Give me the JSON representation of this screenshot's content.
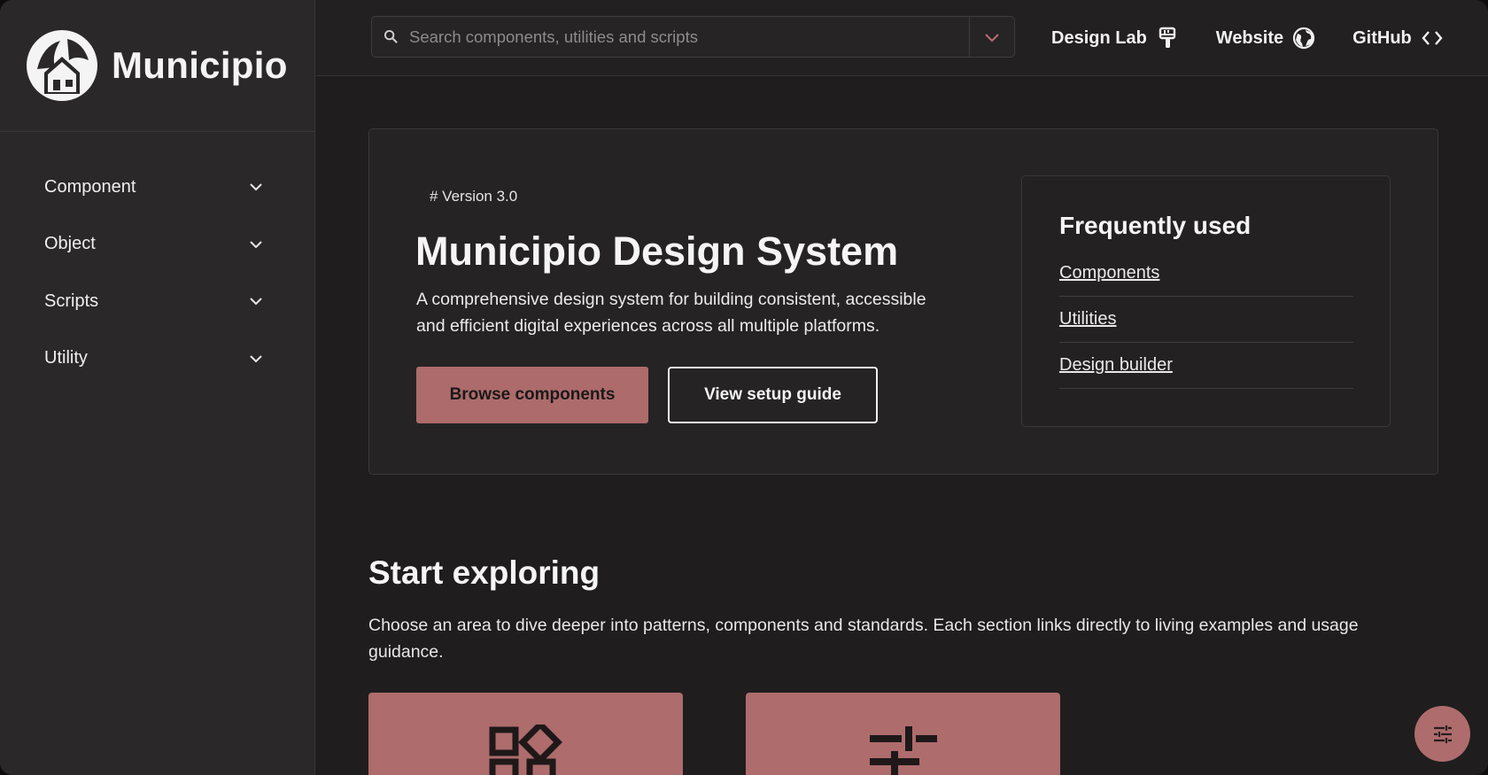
{
  "brand": {
    "name": "Municipio"
  },
  "sidebar": {
    "items": [
      {
        "label": "Component",
        "icon": "chevron-down-icon"
      },
      {
        "label": "Object",
        "icon": "chevron-down-icon"
      },
      {
        "label": "Scripts",
        "icon": "chevron-down-icon"
      },
      {
        "label": "Utility",
        "icon": "chevron-down-icon"
      }
    ]
  },
  "header": {
    "search_placeholder": "Search components, utilities and scripts",
    "search_value": "",
    "links": [
      {
        "label": "Design Lab",
        "icon": "brush-icon"
      },
      {
        "label": "Website",
        "icon": "globe-icon"
      },
      {
        "label": "GitHub",
        "icon": "code-icon"
      }
    ]
  },
  "hero": {
    "version": "# Version 3.0",
    "title": "Municipio Design System",
    "description": "A comprehensive design system for building consistent, accessible and efficient digital experiences across all multiple platforms.",
    "primary_button": "Browse components",
    "secondary_button": "View setup guide"
  },
  "frequently_used": {
    "title": "Frequently used",
    "links": [
      "Components",
      "Utilities",
      "Design builder"
    ]
  },
  "explore": {
    "title": "Start exploring",
    "description": "Choose an area to dive deeper into patterns, components and standards. Each section links directly to living examples and usage guidance.",
    "cards": [
      {
        "icon": "widgets-icon"
      },
      {
        "icon": "tune-icon"
      }
    ]
  },
  "colors": {
    "accent": "#ad6b6b",
    "background": "#1f1d1e",
    "sidebar": "#2a2829"
  }
}
